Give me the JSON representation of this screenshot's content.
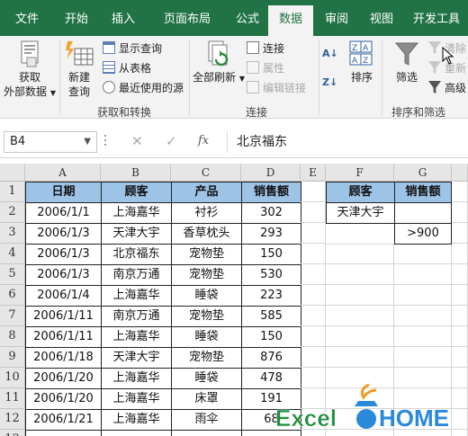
{
  "tabs": [
    {
      "label": "文件"
    },
    {
      "label": "开始"
    },
    {
      "label": "插入"
    },
    {
      "label": "页面布局"
    },
    {
      "label": "公式"
    },
    {
      "label": "数据"
    },
    {
      "label": "审阅"
    },
    {
      "label": "视图"
    },
    {
      "label": "开发工具"
    }
  ],
  "ribbon": {
    "get_external": "获取\n外部数据",
    "new_query": "新建\n查询",
    "show_queries": "显示查询",
    "from_table": "从表格",
    "recent_sources": "最近使用的源",
    "group_get_transform": "获取和转换",
    "refresh_all": "全部刷新",
    "connections": "连接",
    "properties": "属性",
    "edit_links": "编辑链接",
    "group_connections": "连接",
    "sort": "排序",
    "filter": "筛选",
    "clear": "清除",
    "reapply": "重新",
    "advanced": "高级",
    "group_sort_filter": "排序和筛选"
  },
  "formula_bar": {
    "name_box": "B4",
    "fx": "fx",
    "formula": "北京福东"
  },
  "columns": [
    "A",
    "B",
    "C",
    "D",
    "E",
    "F",
    "G"
  ],
  "rows": [
    "1",
    "2",
    "3",
    "4",
    "5",
    "6",
    "7",
    "8",
    "9",
    "10",
    "11",
    "12",
    "13"
  ],
  "table": {
    "headers": [
      "日期",
      "顾客",
      "产品",
      "销售额"
    ],
    "records": [
      [
        "2006/1/1",
        "上海嘉华",
        "衬衫",
        "302"
      ],
      [
        "2006/1/3",
        "天津大宇",
        "香草枕头",
        "293"
      ],
      [
        "2006/1/3",
        "北京福东",
        "宠物垫",
        "150"
      ],
      [
        "2006/1/3",
        "南京万通",
        "宠物垫",
        "530"
      ],
      [
        "2006/1/4",
        "上海嘉华",
        "睡袋",
        "223"
      ],
      [
        "2006/1/11",
        "南京万通",
        "宠物垫",
        "585"
      ],
      [
        "2006/1/11",
        "上海嘉华",
        "睡袋",
        "150"
      ],
      [
        "2006/1/18",
        "天津大宇",
        "宠物垫",
        "876"
      ],
      [
        "2006/1/20",
        "上海嘉华",
        "睡袋",
        "478"
      ],
      [
        "2006/1/20",
        "上海嘉华",
        "床罩",
        "191"
      ],
      [
        "2006/1/21",
        "上海嘉华",
        "雨伞",
        "68"
      ],
      [
        "",
        "",
        "",
        ""
      ]
    ]
  },
  "criteria": {
    "headers": [
      "顾客",
      "销售额"
    ],
    "row1": [
      "天津大宇",
      ""
    ],
    "row2": [
      "",
      ">900"
    ]
  },
  "watermark": {
    "text_left": "Excel",
    "text_right": "HOME",
    "color_left": "#1e8f3a",
    "color_right": "#2a8ad9"
  },
  "colors": {
    "accent": "#217346",
    "header_fill": "#9dc3e6"
  }
}
